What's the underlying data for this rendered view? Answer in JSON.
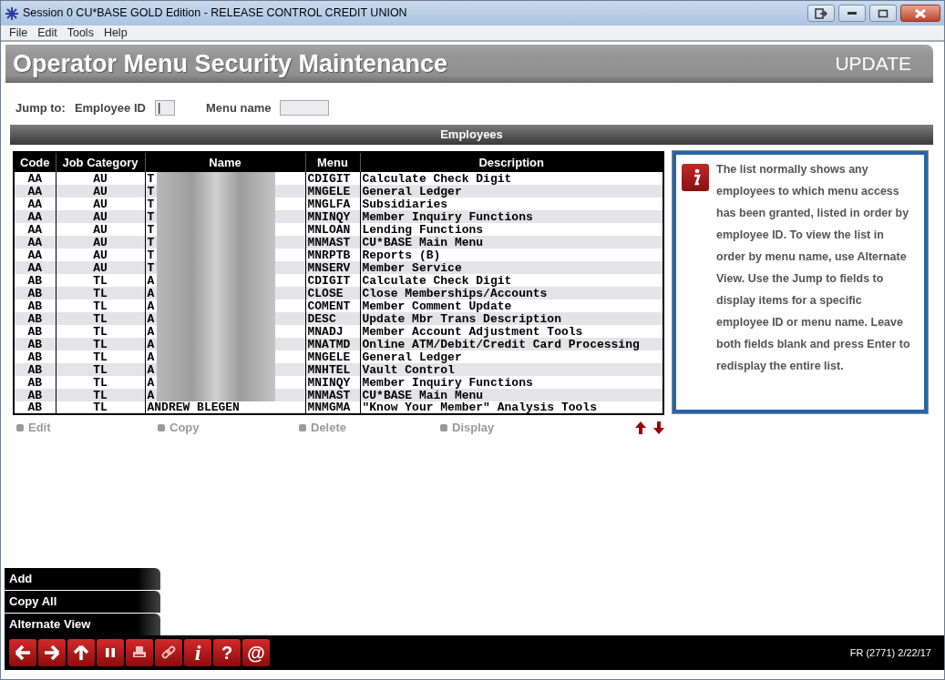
{
  "window": {
    "title": "Session 0 CU*BASE GOLD Edition - RELEASE CONTROL CREDIT UNION"
  },
  "menu_bar": [
    "File",
    "Edit",
    "Tools",
    "Help"
  ],
  "header": {
    "title": "Operator Menu Security Maintenance",
    "mode": "UPDATE"
  },
  "jump_to": {
    "label": "Jump to:",
    "fields": [
      {
        "label": "Employee ID",
        "value": "|"
      },
      {
        "label": "Menu name"
      }
    ]
  },
  "section_title": "Employees",
  "table": {
    "columns": [
      "Code",
      "Job Category",
      "Name",
      "Menu",
      "Description"
    ],
    "rows": [
      {
        "cells": [
          "AA",
          "AU",
          "T",
          "CDIGIT",
          "Calculate Check Digit"
        ],
        "redacted": true
      },
      {
        "cells": [
          "AA",
          "AU",
          "T",
          "MNGELE",
          "General Ledger"
        ],
        "redacted": true
      },
      {
        "cells": [
          "AA",
          "AU",
          "T",
          "MNGLFA",
          "Subsidiaries"
        ],
        "redacted": true
      },
      {
        "cells": [
          "AA",
          "AU",
          "T",
          "MNINQY",
          "Member Inquiry Functions"
        ],
        "redacted": true
      },
      {
        "cells": [
          "AA",
          "AU",
          "T",
          "MNLOAN",
          "Lending Functions"
        ],
        "redacted": true
      },
      {
        "cells": [
          "AA",
          "AU",
          "T",
          "MNMAST",
          "CU*BASE Main Menu"
        ],
        "redacted": true
      },
      {
        "cells": [
          "AA",
          "AU",
          "T",
          "MNRPTB",
          "Reports (B)"
        ],
        "redacted": true
      },
      {
        "cells": [
          "AA",
          "AU",
          "T",
          "MNSERV",
          "Member Service"
        ],
        "redacted": true
      },
      {
        "cells": [
          "AB",
          "TL",
          "A",
          "CDIGIT",
          "Calculate Check Digit"
        ],
        "redacted": true
      },
      {
        "cells": [
          "AB",
          "TL",
          "A",
          "CLOSE",
          "Close Memberships/Accounts"
        ],
        "redacted": true
      },
      {
        "cells": [
          "AB",
          "TL",
          "A",
          "COMENT",
          "Member Comment Update"
        ],
        "redacted": true
      },
      {
        "cells": [
          "AB",
          "TL",
          "A",
          "DESC",
          "Update Mbr Trans Description"
        ],
        "redacted": true
      },
      {
        "cells": [
          "AB",
          "TL",
          "A",
          "MNADJ",
          "Member Account Adjustment Tools"
        ],
        "redacted": true
      },
      {
        "cells": [
          "AB",
          "TL",
          "A",
          "MNATMD",
          "Online ATM/Debit/Credit Card Processing"
        ],
        "redacted": true
      },
      {
        "cells": [
          "AB",
          "TL",
          "A",
          "MNGELE",
          "General Ledger"
        ],
        "redacted": true
      },
      {
        "cells": [
          "AB",
          "TL",
          "A",
          "MNHTEL",
          "Vault Control"
        ],
        "redacted": true
      },
      {
        "cells": [
          "AB",
          "TL",
          "A",
          "MNINQY",
          "Member Inquiry Functions"
        ],
        "redacted": true
      },
      {
        "cells": [
          "AB",
          "TL",
          "A",
          "MNMAST",
          "CU*BASE Main Menu"
        ],
        "redacted": true
      },
      {
        "cells": [
          "AB",
          "TL",
          "ANDREW BLEGEN",
          "MNMGMA",
          "\"Know Your Member\" Analysis Tools"
        ],
        "redacted": false
      }
    ]
  },
  "row_actions": [
    {
      "label": "Edit",
      "disabled": true
    },
    {
      "label": "Copy",
      "disabled": true
    },
    {
      "label": "Delete",
      "disabled": true
    },
    {
      "label": "Display",
      "disabled": true
    }
  ],
  "info_text": "The list normally shows any employees to which menu access has been granted, listed in order by employee ID. To view the list in order by menu name, use Alternate View. Use the Jump to fields to display items for a specific employee ID or menu name. Leave both fields blank and press Enter to redisplay the entire list.",
  "command_buttons": [
    "Add",
    "Copy All",
    "Alternate View"
  ],
  "toolbar": {
    "glyph_buttons": [
      "i",
      "?",
      "@"
    ]
  },
  "status": "FR (2771) 2/22/17"
}
